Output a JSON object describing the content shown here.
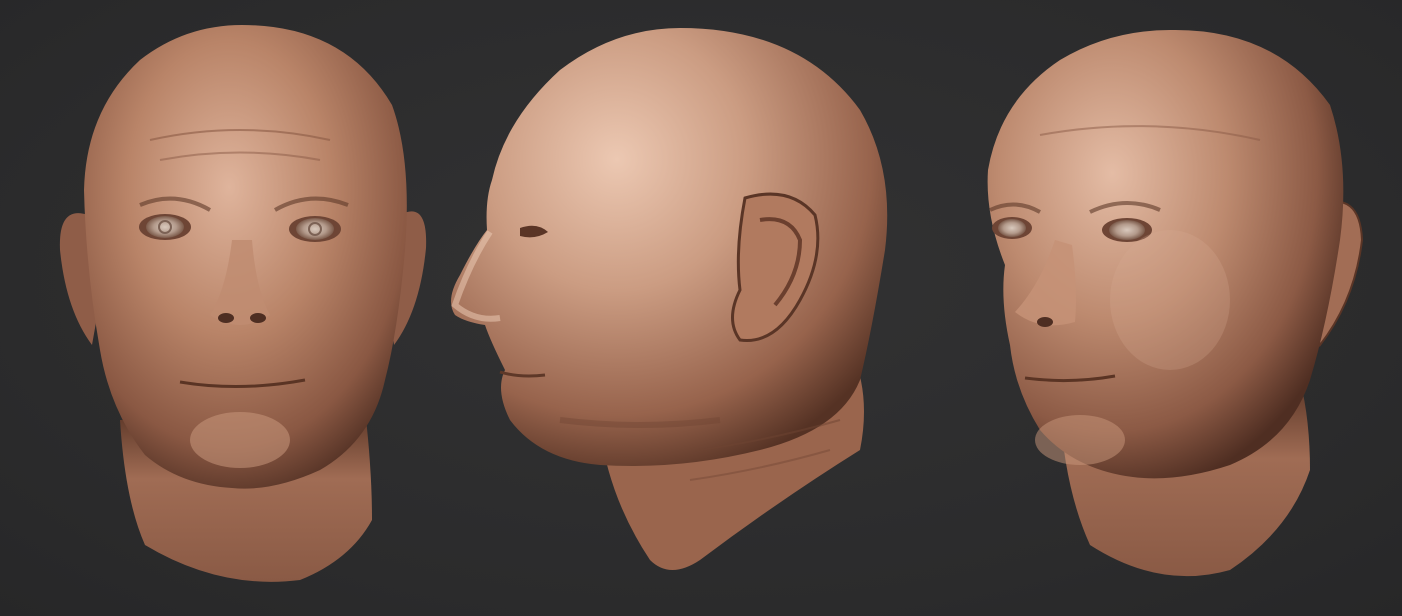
{
  "scene": {
    "background_color": "#2c2c2d",
    "material_color": "#b8826a",
    "material_highlight": "#e3bca5",
    "material_shadow": "#4a2c20",
    "views": [
      {
        "id": "front",
        "kind": "front-view"
      },
      {
        "id": "profile",
        "kind": "side-view"
      },
      {
        "id": "three-quarter",
        "kind": "three-quarter-view"
      }
    ]
  }
}
